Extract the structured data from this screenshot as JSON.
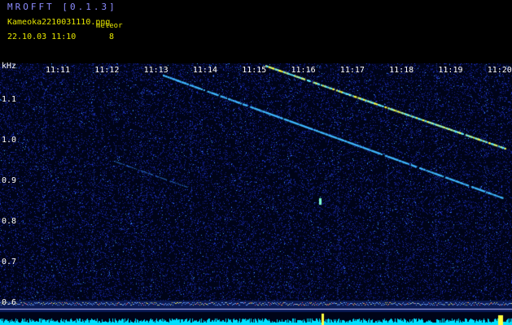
{
  "header": {
    "app_title": "MROFFT [0.1.3]",
    "filename": "Kameoka2210031110.png",
    "datetime": "22.10.03 11:10",
    "meteor_label": "meteor",
    "meteor_count": "8"
  },
  "spectrogram": {
    "freq_unit": "kHz",
    "time_labels": [
      "11:11",
      "11:12",
      "11:13",
      "11:14",
      "11:15",
      "11:16",
      "11:17",
      "11:18",
      "11:19",
      "11:20"
    ],
    "freq_labels": [
      "1.1",
      "1.0",
      "0.9",
      "0.8",
      "0.7",
      "0.6"
    ],
    "colors": {
      "background": "#000418",
      "noise": "#1a2fbf",
      "trace": "#40e0ff",
      "hot": "#ffff40",
      "level": "#00e0ff"
    }
  }
}
